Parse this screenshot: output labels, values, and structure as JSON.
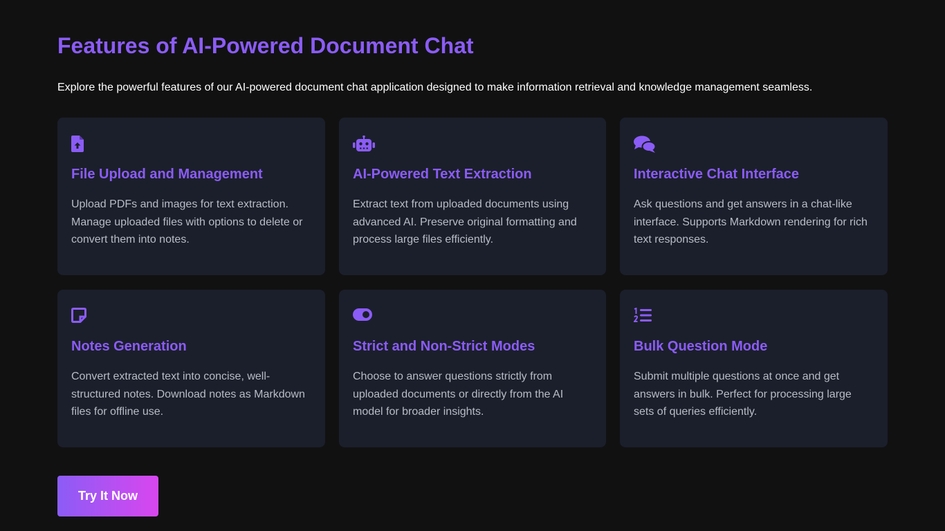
{
  "header": {
    "title": "Features of AI-Powered Document Chat",
    "subtitle": "Explore the powerful features of our AI-powered document chat application designed to make information retrieval and knowledge management seamless."
  },
  "colors": {
    "accent": "#8b5cf6",
    "background": "#111112",
    "card": "#1b1f2b",
    "cta_gradient_start": "#8b5cf6",
    "cta_gradient_end": "#d946ef"
  },
  "features": [
    {
      "icon": "file-upload-icon",
      "title": "File Upload and Management",
      "description": "Upload PDFs and images for text extraction. Manage uploaded files with options to delete or convert them into notes."
    },
    {
      "icon": "robot-icon",
      "title": "AI-Powered Text Extraction",
      "description": "Extract text from uploaded documents using advanced AI. Preserve original formatting and process large files efficiently."
    },
    {
      "icon": "chat-bubbles-icon",
      "title": "Interactive Chat Interface",
      "description": "Ask questions and get answers in a chat-like interface. Supports Markdown rendering for rich text responses."
    },
    {
      "icon": "sticky-note-icon",
      "title": "Notes Generation",
      "description": "Convert extracted text into concise, well-structured notes. Download notes as Markdown files for offline use."
    },
    {
      "icon": "toggle-icon",
      "title": "Strict and Non-Strict Modes",
      "description": "Choose to answer questions strictly from uploaded documents or directly from the AI model for broader insights."
    },
    {
      "icon": "numbered-list-icon",
      "title": "Bulk Question Mode",
      "description": "Submit multiple questions at once and get answers in bulk. Perfect for processing large sets of queries efficiently."
    }
  ],
  "cta": {
    "label": "Try It Now"
  }
}
